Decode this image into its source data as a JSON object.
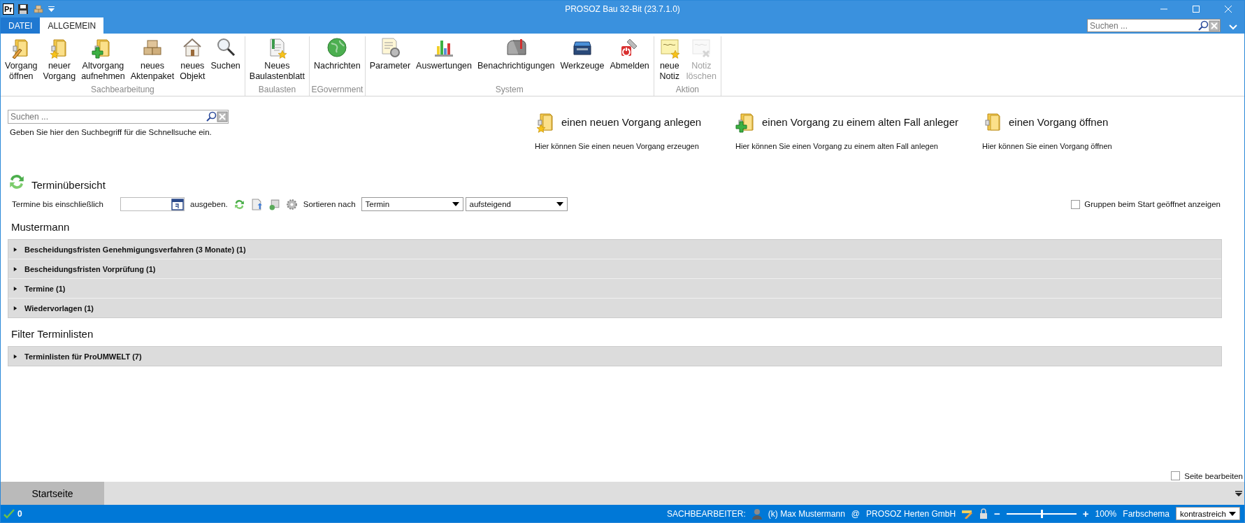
{
  "window": {
    "title": "PROSOZ Bau 32-Bit (23.7.1.0)",
    "app_logo": "Pr"
  },
  "ribbon_tabs": [
    {
      "label": "DATEI",
      "selected": false
    },
    {
      "label": "ALLGEMEIN",
      "selected": true
    }
  ],
  "ribbon_search": {
    "placeholder": "Suchen ..."
  },
  "ribbon_groups": [
    {
      "label": "Sachbearbeitung",
      "buttons": [
        {
          "label": "Vorgang\nöffnen",
          "disabled": false
        },
        {
          "label": "neuer\nVorgang",
          "disabled": false
        },
        {
          "label": "Altvorgang\naufnehmen",
          "disabled": false
        },
        {
          "label": "neues\nAktenpaket",
          "disabled": false
        },
        {
          "label": "neues\nObjekt",
          "disabled": false
        },
        {
          "label": "Suchen",
          "disabled": false
        }
      ]
    },
    {
      "label": "Baulasten",
      "buttons": [
        {
          "label": "Neues\nBaulastenblatt",
          "disabled": false
        }
      ]
    },
    {
      "label": "EGovernment",
      "buttons": [
        {
          "label": "Nachrichten",
          "disabled": false
        }
      ]
    },
    {
      "label": "System",
      "buttons": [
        {
          "label": "Parameter",
          "disabled": false
        },
        {
          "label": "Auswertungen",
          "disabled": false
        },
        {
          "label": "Benachrichtigungen",
          "disabled": false
        },
        {
          "label": "Werkzeuge",
          "disabled": false
        },
        {
          "label": "Abmelden",
          "disabled": false
        }
      ]
    },
    {
      "label": "Aktion",
      "buttons": [
        {
          "label": "neue\nNotiz",
          "disabled": false
        },
        {
          "label": "Notiz\nlöschen",
          "disabled": true
        }
      ]
    }
  ],
  "quick_search": {
    "placeholder": "Suchen ...",
    "hint": "Geben Sie hier den Suchbegriff für die Schnellsuche ein."
  },
  "actions": [
    {
      "title": "einen neuen Vorgang anlegen",
      "description": "Hier können Sie einen neuen Vorgang erzeugen"
    },
    {
      "title": "einen Vorgang zu einem alten Fall anleger",
      "description": "Hier können Sie einen Vorgang zu einem alten Fall anlegen"
    },
    {
      "title": "einen Vorgang öffnen",
      "description": "Hier können Sie einen Vorgang öffnen"
    }
  ],
  "appointments": {
    "title": "Terminübersicht",
    "until_label": "Termine bis einschließlich",
    "output_label": "ausgeben.",
    "sort_label": "Sortieren nach",
    "sort_field": "Termin",
    "sort_order": "aufsteigend",
    "open_groups": {
      "label": "Gruppen beim Start geöffnet anzeigen",
      "checked": false
    },
    "owner": "Mustermann",
    "groups": [
      {
        "label": "Bescheidungsfristen Genehmigungsverfahren (3 Monate) (1)",
        "expanded": false
      },
      {
        "label": "Bescheidungsfristen Vorprüfung (1)",
        "expanded": false
      },
      {
        "label": "Termine (1)",
        "expanded": false
      },
      {
        "label": "Wiedervorlagen (1)",
        "expanded": false
      }
    ]
  },
  "filter": {
    "title": "Filter Terminlisten",
    "groups": [
      {
        "label": "Terminlisten für ProUMWELT (7)",
        "expanded": false
      }
    ]
  },
  "edit_page": {
    "label": "Seite bearbeiten",
    "checked": false
  },
  "page_tabs": [
    {
      "label": "Startseite",
      "selected": true
    }
  ],
  "status_bar": {
    "count": "0",
    "role": "SACHBEARBEITER:",
    "user": "(k) Max Mustermann",
    "at": "@",
    "organization": "PROSOZ Herten GmbH",
    "zoom_out": "−",
    "zoom_in": "+",
    "zoom": {
      "level": 0.5
    },
    "zoom_reading": "100%",
    "scheme_label": "Farbschema",
    "scheme": "kontrastreich"
  }
}
